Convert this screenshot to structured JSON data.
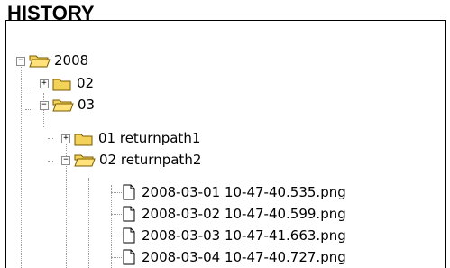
{
  "panel": {
    "title": "HISTORY"
  },
  "tree": {
    "nodes": [
      {
        "label": "2008",
        "type": "folder",
        "state": "open",
        "toggle": "−"
      },
      {
        "label": "02",
        "type": "folder",
        "state": "closed",
        "toggle": "+"
      },
      {
        "label": "03",
        "type": "folder",
        "state": "open",
        "toggle": "−"
      },
      {
        "label": "01 returnpath1",
        "type": "folder",
        "state": "closed",
        "toggle": "+"
      },
      {
        "label": "02 returnpath2",
        "type": "folder",
        "state": "open",
        "toggle": "−"
      },
      {
        "label": "2008-03-01 10-47-40.535.png",
        "type": "file"
      },
      {
        "label": "2008-03-02 10-47-40.599.png",
        "type": "file"
      },
      {
        "label": "2008-03-03 10-47-41.663.png",
        "type": "file"
      },
      {
        "label": "2008-03-04 10-47-40.727.png",
        "type": "file"
      }
    ]
  }
}
